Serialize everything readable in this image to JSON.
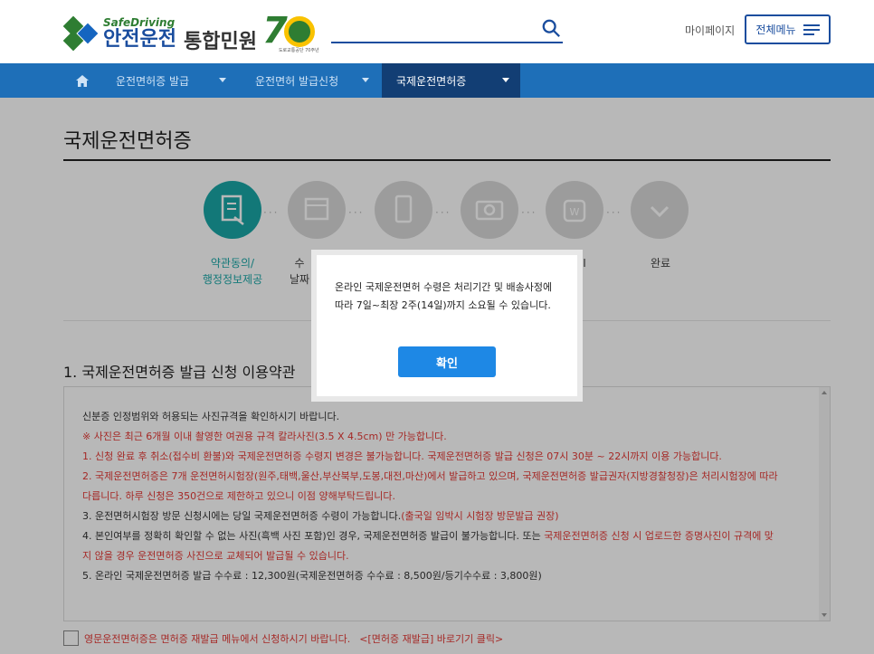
{
  "header": {
    "logo_sub": "SafeDriving",
    "logo_main": "안전운전",
    "logo_main2": "통합민원",
    "logo_tiny": "도로교통공단 70주년",
    "mypage": "마이페이지",
    "all_menu": "전체메뉴"
  },
  "nav": {
    "items": [
      {
        "label": "운전면허증 발급"
      },
      {
        "label": "운전면허 발급신청"
      },
      {
        "label": "국제운전면허증"
      }
    ]
  },
  "page": {
    "title": "국제운전면허증"
  },
  "steps": {
    "labels": {
      "s1_line1": "약관동의/",
      "s1_line2": "행정정보제공",
      "s2_line1": "수",
      "s2_line2": "날짜",
      "s5": "I",
      "s6": "완료"
    }
  },
  "terms": {
    "section_title": "1. 국제운전면허증 발급 신청 이용약관",
    "lines": {
      "l1": "신분증 인정범위와 허용되는 사진규격을 확인하시기 바랍니다.",
      "l2": "※ 사진은 최근 6개월 이내 촬영한 여권용 규격 칼라사진(3.5 X 4.5cm) 만 가능합니다.",
      "l3": "1. 신청 완료 후 취소(접수비 환불)와 국제운전면허증 수령지 변경은 불가능합니다. 국제운전면허증 발급 신청은 07시 30분 ~ 22시까지 이용 가능합니다.",
      "l4": "2. 국제운전면허증은 7개 운전면허시험장(원주,태백,울산,부산북부,도봉,대전,마산)에서 발급하고 있으며, 국제운전면허증 발급권자(지방경찰청장)은 처리시험장에 따라",
      "l5": "다릅니다. 하루 신청은 350건으로 제한하고 있으니 이점 양해부탁드립니다.",
      "l6a": "3. 운전면허시험장 방문 신청시에는 당일 국제운전면허증 수령이 가능합니다.",
      "l6b": "(출국일 임박시 시험장 방문발급 권장)",
      "l7a": "4. 본인여부를 정확히 확인할 수 없는 사진(흑백 사진 포함)인 경우, 국제운전면허증 발급이 불가능합니다. 또는 ",
      "l7b": "국제운전면허증 신청 시 업로드한 증명사진이 규격에 맞",
      "l8": "지 않을 경우 운전면허증 사진으로 교체되어 발급될 수 있습니다.",
      "l9": "5. 온라인 국제운전면허증 발급 수수료 : 12,300원(국제운전면허증 수수료 : 8,500원/등기수수료 : 3,800원)"
    }
  },
  "agree": {
    "text": "영문운전면허증은 면허증 재발급 메뉴에서 신청하시기 바랍니다.",
    "link": "<[면허증 재발급] 바로기기 클릭>"
  },
  "modal": {
    "message_line1": "온라인 국제운전면허 수령은 처리기간 및 배송사정에",
    "message_line2": "따라 7일~최장 2주(14일)까지 소요될 수 있습니다.",
    "confirm": "확인"
  },
  "colors": {
    "brand_blue": "#1a4d9e",
    "nav_blue": "#1e6fb8",
    "nav_active": "#123e74",
    "step_active": "#1aa7a7",
    "warning_red": "#e53935",
    "button_blue": "#1e88e5"
  }
}
